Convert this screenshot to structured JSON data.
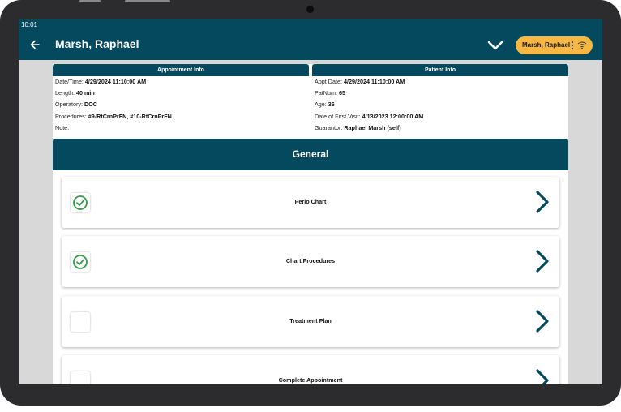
{
  "status_bar": {
    "time": "10:01"
  },
  "header": {
    "title": "Marsh, Raphael",
    "patient_pill": "Marsh, Raphael"
  },
  "appointment_info": {
    "title": "Appointment Info",
    "rows": [
      {
        "label": "Date/Time:",
        "value": "4/29/2024 11:10:00 AM"
      },
      {
        "label": "Length:",
        "value": "40 min"
      },
      {
        "label": "Operatory:",
        "value": "DOC"
      },
      {
        "label": "Procedures:",
        "value": "#9-RtCrnPrFN, #10-RtCrnPrFN"
      },
      {
        "label": "Note:",
        "value": ""
      }
    ]
  },
  "patient_info": {
    "title": "Patient Info",
    "rows": [
      {
        "label": "Appt Date:",
        "value": "4/29/2024 11:10:00 AM"
      },
      {
        "label": "PatNum:",
        "value": "65"
      },
      {
        "label": "Age:",
        "value": "36"
      },
      {
        "label": "Date of First Visit:",
        "value": "4/13/2023 12:00:00 AM"
      },
      {
        "label": "Guarantor:",
        "value": "Raphael Marsh (self)"
      }
    ]
  },
  "general": {
    "title": "General",
    "items": [
      {
        "label": "Perio Chart",
        "checked": true
      },
      {
        "label": "Chart Procedures",
        "checked": true
      },
      {
        "label": "Treatment Plan",
        "checked": false
      },
      {
        "label": "Complete Appointment",
        "checked": false
      }
    ]
  },
  "colors": {
    "header": "#05495f",
    "accent_pill": "#f6b842",
    "check": "#2e9e45"
  },
  "icons": [
    "back-arrow-icon",
    "chevron-down-icon",
    "more-vert-icon",
    "wifi-icon",
    "check-circle-icon",
    "chevron-right-icon"
  ]
}
